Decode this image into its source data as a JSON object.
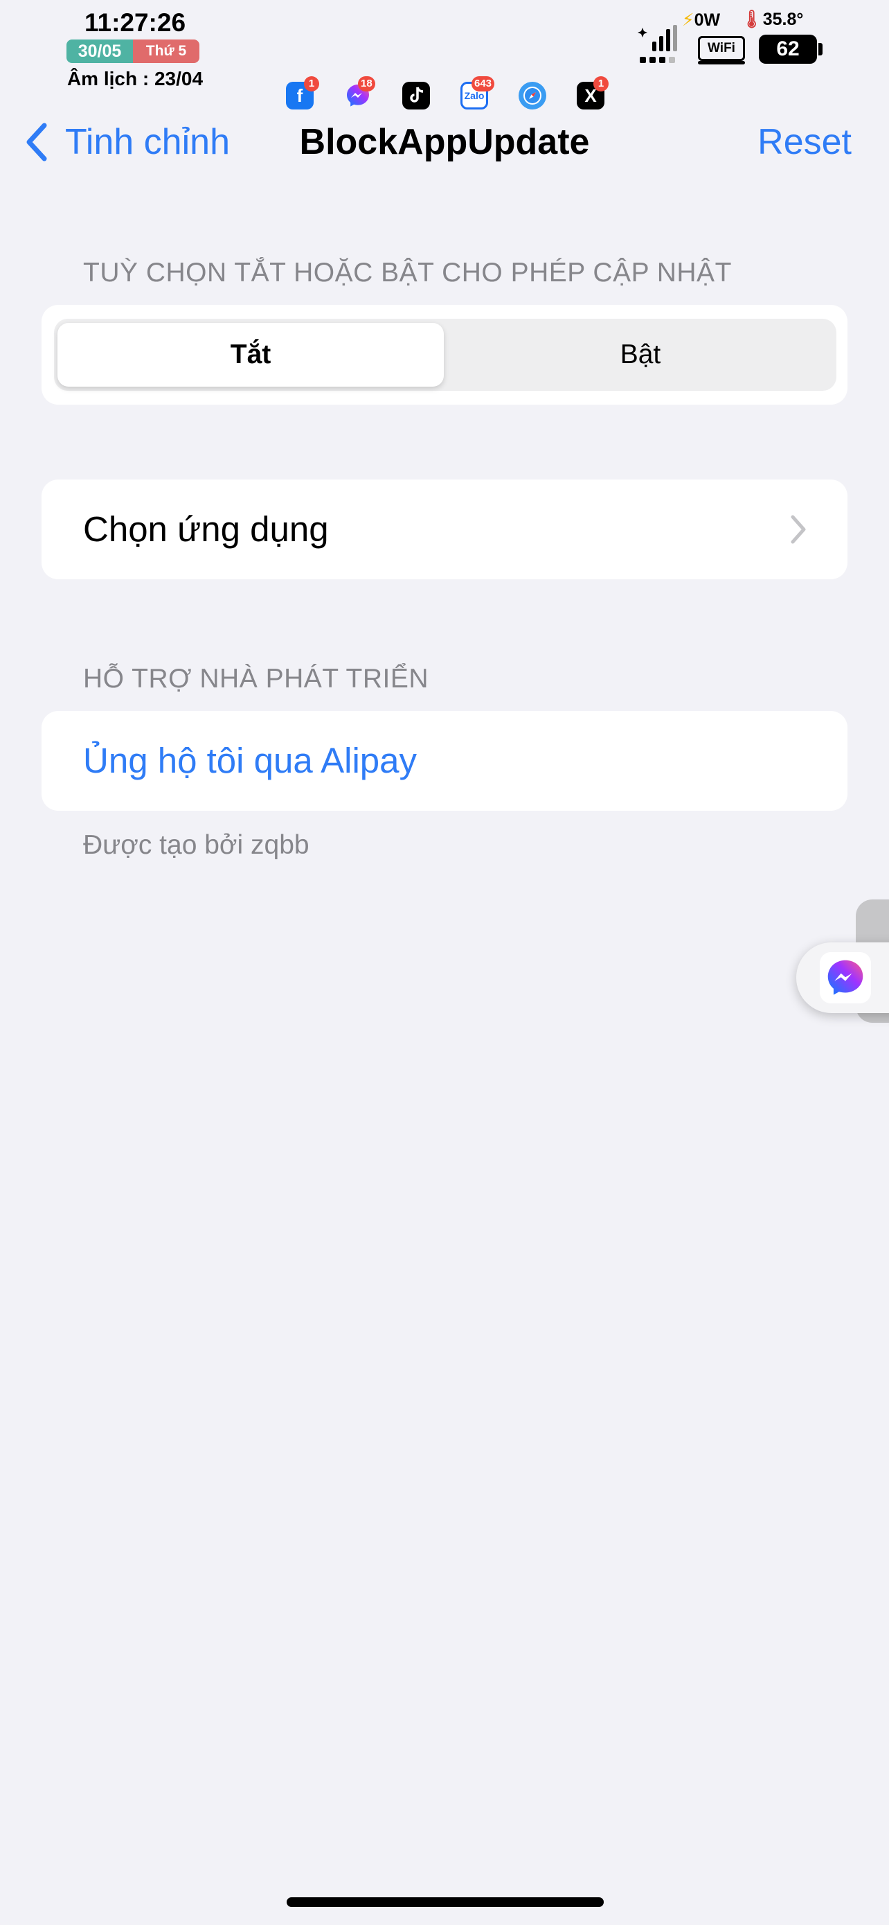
{
  "status_bar": {
    "time": "11:27:26",
    "date": "30/05",
    "weekday": "Thứ 5",
    "lunar": "Âm lịch : 23/04",
    "charging": "0W",
    "temperature": "35.8°",
    "wifi_label": "WiFi",
    "battery": "62"
  },
  "notifications": [
    {
      "app": "facebook",
      "badge": "1"
    },
    {
      "app": "messenger",
      "badge": "18"
    },
    {
      "app": "tiktok",
      "badge": ""
    },
    {
      "app": "zalo",
      "badge": "643",
      "label": "Zalo"
    },
    {
      "app": "safari",
      "badge": ""
    },
    {
      "app": "x",
      "badge": "1",
      "label": "X"
    }
  ],
  "nav": {
    "back_label": "Tinh chỉnh",
    "title": "BlockAppUpdate",
    "reset_label": "Reset"
  },
  "toggle_section": {
    "header": "TUỲ CHỌN TẮT HOẶC BẬT CHO PHÉP CẬP NHẬT",
    "options": [
      "Tắt",
      "Bật"
    ],
    "selected": "Tắt"
  },
  "apps_row": {
    "label": "Chọn ứng dụng"
  },
  "developer_section": {
    "header": "HỖ TRỢ NHÀ PHÁT TRIỂN",
    "donate_label": "Ủng hộ tôi qua Alipay",
    "footer": "Được tạo bởi zqbb"
  },
  "colors": {
    "accent": "#2f7cf6",
    "background": "#f2f2f7",
    "secondary_text": "#86868b"
  }
}
